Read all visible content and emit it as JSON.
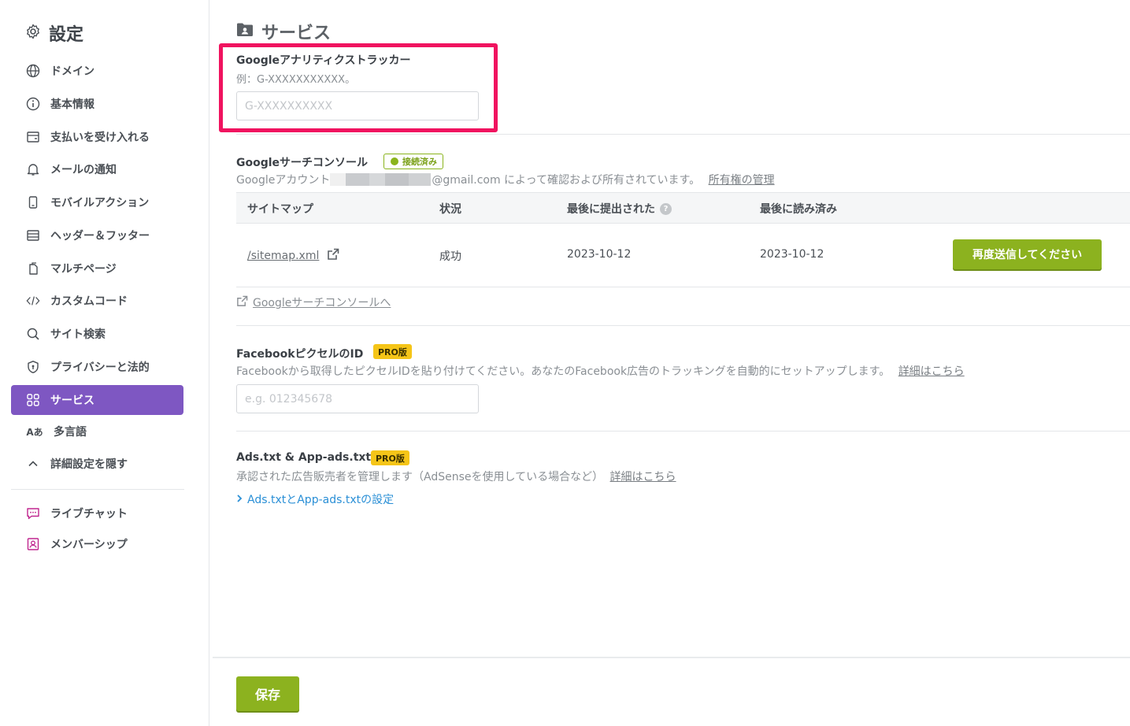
{
  "sidebar": {
    "title": "設定",
    "title_icon": "gear-icon",
    "items": [
      {
        "label": "ドメイン",
        "icon": "globe-icon"
      },
      {
        "label": "基本情報",
        "icon": "info-circle-icon"
      },
      {
        "label": "支払いを受け入れる",
        "icon": "wallet-icon"
      },
      {
        "label": "メールの通知",
        "icon": "bell-icon"
      },
      {
        "label": "モバイルアクション",
        "icon": "mobile-icon"
      },
      {
        "label": "ヘッダー＆フッター",
        "icon": "layout-icon"
      },
      {
        "label": "マルチページ",
        "icon": "pages-icon"
      },
      {
        "label": "カスタムコード",
        "icon": "code-icon"
      },
      {
        "label": "サイト検索",
        "icon": "search-icon"
      },
      {
        "label": "プライバシーと法的",
        "icon": "shield-icon"
      },
      {
        "label": "サービス",
        "icon": "grid-icon",
        "active": true
      },
      {
        "label": "多言語",
        "icon": "language-icon"
      },
      {
        "label": "詳細設定を隠す",
        "icon": "chevron-up-icon"
      }
    ],
    "extras": [
      {
        "label": "ライブチャット",
        "icon": "chat-icon"
      },
      {
        "label": "メンバーシップ",
        "icon": "member-icon"
      }
    ]
  },
  "main": {
    "page_title": "サービス",
    "page_icon": "folder-user-icon",
    "google_analytics": {
      "label": "Googleアナリティクストラッカー",
      "hint": "例：G-XXXXXXXXXXX。",
      "placeholder": "G-XXXXXXXXXX",
      "value": ""
    },
    "search_console": {
      "label": "Googleサーチコンソール",
      "status": "接続済み",
      "desc_prefix": "Googleアカウント",
      "desc_suffix": "@gmail.com によって確認および所有されています。",
      "manage_link": "所有権の管理",
      "table": {
        "headers": [
          "サイトマップ",
          "状況",
          "最後に提出された",
          "最後に読み済み"
        ],
        "rows": [
          {
            "sitemap": "/sitemap.xml",
            "status": "成功",
            "submitted": "2023-10-12",
            "read": "2023-10-12",
            "action": "再度送信してください"
          }
        ]
      },
      "console_link": "Googleサーチコンソールへ"
    },
    "facebook_pixel": {
      "label": "FacebookピクセルのID",
      "badge": "PRO版",
      "desc": "Facebookから取得したピクセルIDを貼り付けてください。あなたのFacebook広告のトラッキングを自動的にセットアップします。",
      "more_link": "詳細はこちら",
      "placeholder": "e.g. 012345678",
      "value": ""
    },
    "ads_txt": {
      "label": "Ads.txt & App-ads.txt",
      "badge": "PRO版",
      "desc": "承認された広告販売者を管理します（AdSenseを使用している場合など）",
      "more_link": "詳細はこちら",
      "settings_link": "Ads.txtとApp-ads.txtの設定"
    },
    "save_button": "保存"
  },
  "colors": {
    "accent_purple": "#7e57c2",
    "primary_green": "#8cb21f",
    "highlight_red": "#f0135f",
    "pro_yellow": "#f5c518",
    "link_blue": "#2a8fd6"
  }
}
